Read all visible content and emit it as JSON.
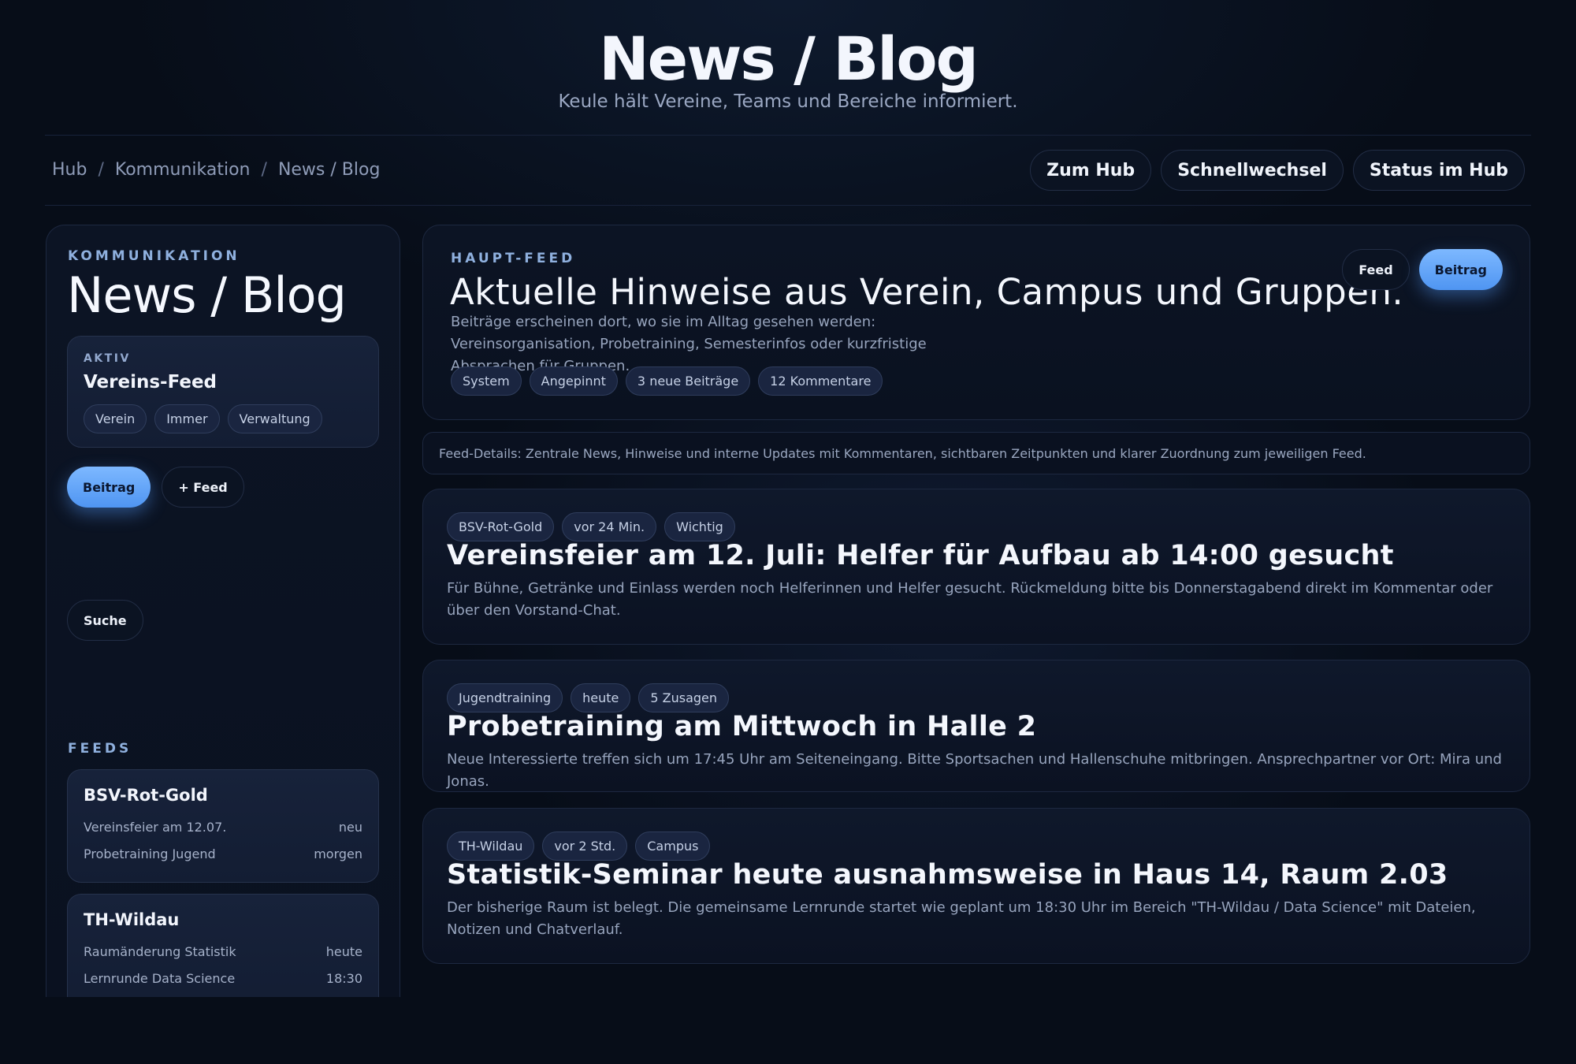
{
  "header": {
    "title": "News / Blog",
    "subtitle": "Keule hält Vereine, Teams und Bereiche informiert."
  },
  "breadcrumb": [
    "Hub",
    "Kommunikation",
    "News / Blog"
  ],
  "breadcrumb_separator": "/",
  "top_actions": [
    "Zum Hub",
    "Schnellwechsel",
    "Status im Hub"
  ],
  "sidebar": {
    "eyebrow": "KOMMUNIKATION",
    "title": "News / Blog",
    "active": {
      "label": "AKTIV",
      "name": "Vereins-Feed",
      "tags": [
        "Verein",
        "Immer",
        "Verwaltung"
      ]
    },
    "primary_button": "Beitrag",
    "secondary_button": "+ Feed",
    "search_button": "Suche",
    "feeds_label": "FEEDS",
    "feeds": [
      {
        "name": "BSV-Rot-Gold",
        "items": [
          {
            "text": "Vereinsfeier am 12.07.",
            "meta": "neu"
          },
          {
            "text": "Probetraining Jugend",
            "meta": "morgen"
          }
        ]
      },
      {
        "name": "TH-Wildau",
        "items": [
          {
            "text": "Raumänderung Statistik",
            "meta": "heute"
          },
          {
            "text": "Lernrunde Data Science",
            "meta": "18:30"
          }
        ]
      }
    ]
  },
  "hero": {
    "eyebrow": "HAUPT-FEED",
    "title": "Aktuelle Hinweise aus Verein, Campus und Gruppen.",
    "description": "Beiträge erscheinen dort, wo sie im Alltag gesehen werden: Vereinsorganisation, Probetraining, Semesterinfos oder kurzfristige Absprachen für Gruppen.",
    "tags": [
      "System",
      "Angepinnt",
      "3 neue Beiträge",
      "12 Kommentare"
    ],
    "view_feed": "Feed",
    "view_post": "Beitrag"
  },
  "details": "Feed-Details: Zentrale News, Hinweise und interne Updates mit Kommentaren, sichtbaren Zeitpunkten und klarer Zuordnung zum jeweiligen Feed.",
  "posts": [
    {
      "tags": [
        "BSV-Rot-Gold",
        "vor 24 Min.",
        "Wichtig"
      ],
      "title": "Vereinsfeier am 12. Juli: Helfer für Aufbau ab 14:00 gesucht",
      "body": "Für Bühne, Getränke und Einlass werden noch Helferinnen und Helfer gesucht. Rückmeldung bitte bis Donnerstagabend direkt im Kommentar oder über den Vorstand-Chat."
    },
    {
      "tags": [
        "Jugendtraining",
        "heute",
        "5 Zusagen"
      ],
      "title": "Probetraining am Mittwoch in Halle 2",
      "body": "Neue Interessierte treffen sich um 17:45 Uhr am Seiteneingang. Bitte Sportsachen und Hallenschuhe mitbringen. Ansprechpartner vor Ort: Mira und Jonas."
    },
    {
      "tags": [
        "TH-Wildau",
        "vor 2 Std.",
        "Campus"
      ],
      "title": "Statistik-Seminar heute ausnahmsweise in Haus 14, Raum 2.03",
      "body": "Der bisherige Raum ist belegt. Die gemeinsame Lernrunde startet wie geplant um 18:30 Uhr im Bereich \"TH-Wildau / Data Science\" mit Dateien, Notizen und Chatverlauf."
    }
  ],
  "colors": {
    "background": "#070d18",
    "accent": "#6aa8fb",
    "eyebrow": "#8fb0de"
  }
}
